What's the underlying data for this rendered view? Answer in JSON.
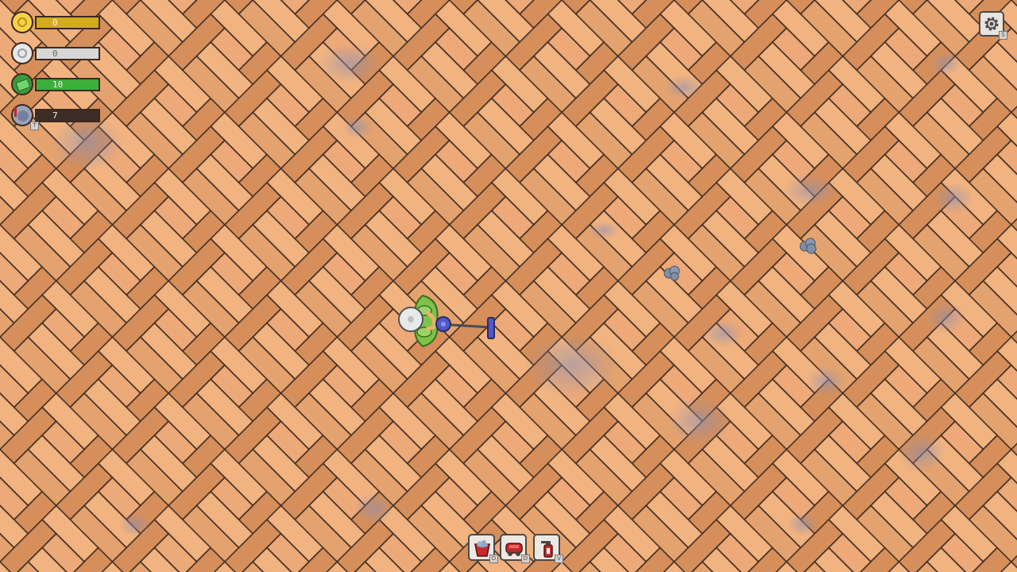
{
  "hud": {
    "resources": [
      {
        "name": "coins",
        "value": "0",
        "color": "#d4ab1c",
        "fill": 1.0,
        "icon": "gold-coin-icon"
      },
      {
        "name": "silver",
        "value": "0",
        "color": "#d7d7d7",
        "fill": 1.0,
        "icon": "silver-coin-icon"
      },
      {
        "name": "cash",
        "value": "10",
        "color": "#3cae3c",
        "fill": 1.0,
        "icon": "cash-icon"
      },
      {
        "name": "dust",
        "value": "7",
        "color": "#3e2c26",
        "fill": 0.0,
        "icon": "dust-bag-icon",
        "key": "T"
      }
    ]
  },
  "settings": {
    "key": "S",
    "icon": "gear-icon"
  },
  "toolbar": [
    {
      "name": "bucket-tool",
      "key": "D",
      "icon": "bucket-icon"
    },
    {
      "name": "vacuum-tool",
      "key": "D",
      "icon": "vacuum-icon"
    },
    {
      "name": "spray-tool",
      "key": "V",
      "icon": "spray-bottle-icon"
    }
  ],
  "colors": {
    "floor_light": "#f2b580",
    "floor_mid": "#e0a06b",
    "floor_dark": "#d38d58",
    "grout": "#3f2d24",
    "dust": "#8c90b8"
  }
}
